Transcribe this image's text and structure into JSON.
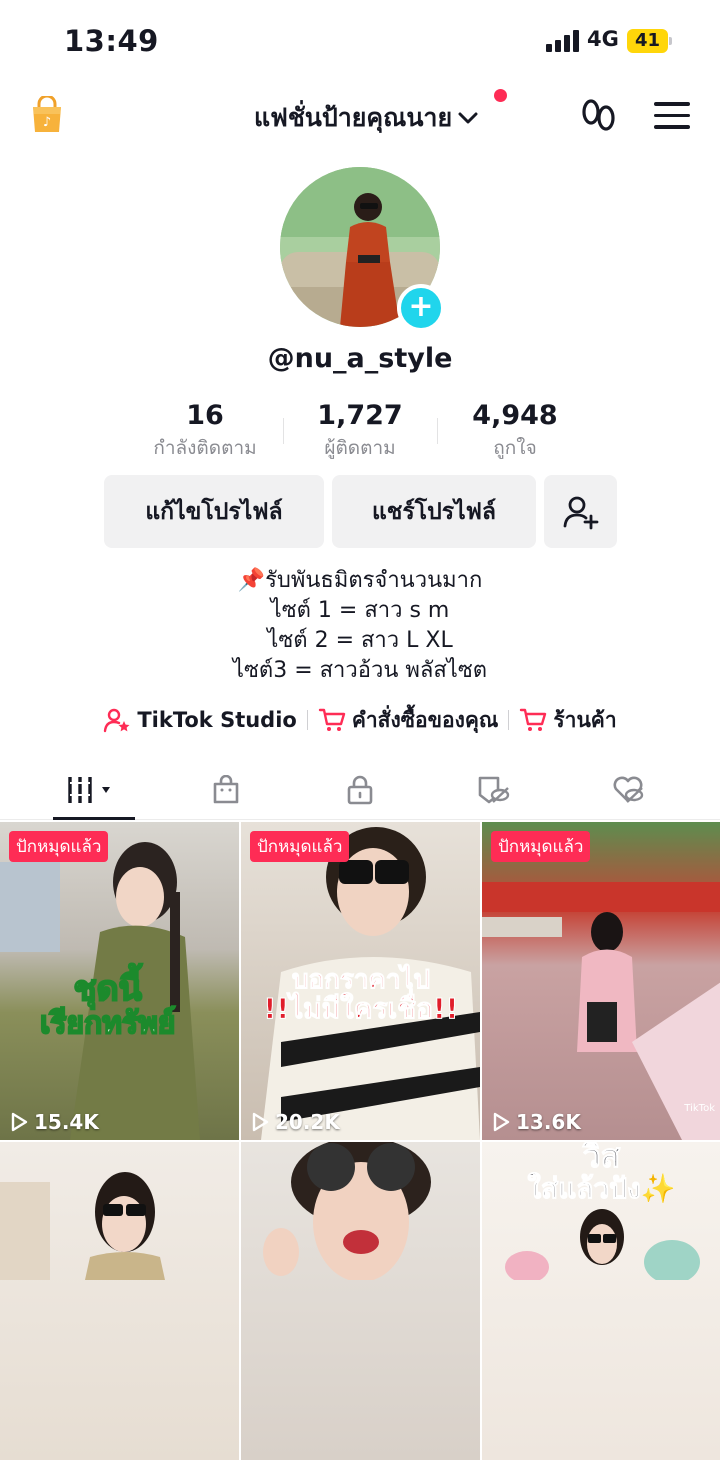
{
  "status_bar": {
    "time": "13:49",
    "network": "4G",
    "battery": "41"
  },
  "header": {
    "account_name": "แฟชั่นป้ายคุณนาย"
  },
  "profile": {
    "username": "@nu_a_style",
    "stats": [
      {
        "value": "16",
        "label": "กำลังติดตาม"
      },
      {
        "value": "1,727",
        "label": "ผู้ติดตาม"
      },
      {
        "value": "4,948",
        "label": "ถูกใจ"
      }
    ],
    "buttons": {
      "edit": "แก้ไขโปรไฟล์",
      "share": "แชร์โปรไฟล์"
    },
    "bio": [
      "📌รับพันธมิตรจำนวนมาก",
      "ไซต์ 1 = สาว s m",
      "ไซต์ 2 = สาว L XL",
      "ไซต์3 = สาวอ้วน พลัสไซต"
    ],
    "links": [
      {
        "label": "TikTok Studio",
        "icon": "person-star-icon"
      },
      {
        "label": "คำสั่งซื้อของคุณ",
        "icon": "cart-icon"
      },
      {
        "label": "ร้านค้า",
        "icon": "cart-icon"
      }
    ]
  },
  "tabs": [
    {
      "name": "videos-grid-icon",
      "active": true
    },
    {
      "name": "shop-bag-icon"
    },
    {
      "name": "lock-icon"
    },
    {
      "name": "hidden-tag-icon"
    },
    {
      "name": "hidden-heart-icon"
    }
  ],
  "videos": [
    {
      "pinned": "ปักหมุดแล้ว",
      "views": "15.4K",
      "caption_line1": "ชุดนี้",
      "caption_line2": "เรียกทรัพย์"
    },
    {
      "pinned": "ปักหมุดแล้ว",
      "views": "20.2K",
      "caption_line1": "บอกราคาไป",
      "caption_line2": "!!ไม่มีใครเชื่อ!!"
    },
    {
      "pinned": "ปักหมุดแล้ว",
      "views": "13.6K",
      "watermark": "TikTok"
    },
    {
      "views": ""
    },
    {
      "views": ""
    },
    {
      "caption_line1": "วิส",
      "caption_line2": "ใส่แล้วปัง✨",
      "views": ""
    }
  ],
  "colors": {
    "accent": "#fe2c55",
    "plus": "#20d5ec",
    "battery": "#ffd60a"
  }
}
